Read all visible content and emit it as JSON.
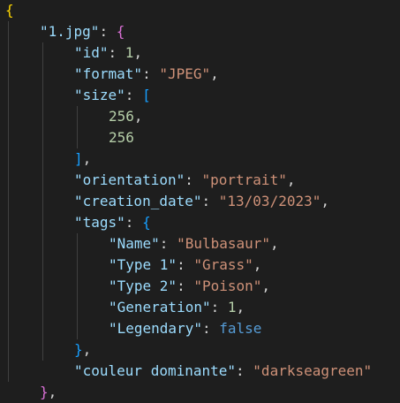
{
  "editor": {
    "language": "json",
    "theme_colors": {
      "background": "#1e1e1e",
      "key": "#9cdcfe",
      "string": "#ce9178",
      "number": "#b5cea8",
      "keyword": "#569cd6",
      "punctuation": "#d4d4d4",
      "bracket_level_1": "#ffd700",
      "bracket_level_2": "#da70d6",
      "bracket_level_3": "#179fff"
    },
    "lines": [
      "{",
      "\"1.jpg\": {",
      "\"id\": 1,",
      "\"format\": \"JPEG\",",
      "\"size\": [",
      "256,",
      "256",
      "],",
      "\"orientation\": \"portrait\",",
      "\"creation_date\": \"13/03/2023\",",
      "\"tags\": {",
      "\"Name\": \"Bulbasaur\",",
      "\"Type 1\": \"Grass\",",
      "\"Type 2\": \"Poison\",",
      "\"Generation\": 1,",
      "\"Legendary\": false",
      "},",
      "\"couleur dominante\": \"darkseagreen\"",
      "},"
    ],
    "tokens": {
      "l1_key": "\"1.jpg\"",
      "id_key": "\"id\"",
      "id_val": "1",
      "format_key": "\"format\"",
      "format_val": "\"JPEG\"",
      "size_key": "\"size\"",
      "size_0": "256",
      "size_1": "256",
      "orientation_key": "\"orientation\"",
      "orientation_val": "\"portrait\"",
      "creation_key": "\"creation_date\"",
      "creation_val": "\"13/03/2023\"",
      "tags_key": "\"tags\"",
      "name_key": "\"Name\"",
      "name_val": "\"Bulbasaur\"",
      "type1_key": "\"Type 1\"",
      "type1_val": "\"Grass\"",
      "type2_key": "\"Type 2\"",
      "type2_val": "\"Poison\"",
      "gen_key": "\"Generation\"",
      "gen_val": "1",
      "leg_key": "\"Legendary\"",
      "leg_val": "false",
      "couleur_key": "\"couleur dominante\"",
      "couleur_val": "\"darkseagreen\""
    },
    "punct": {
      "open_brace": "{",
      "close_brace": "}",
      "open_bracket": "[",
      "close_bracket": "]",
      "colon": ": ",
      "comma": ","
    }
  }
}
